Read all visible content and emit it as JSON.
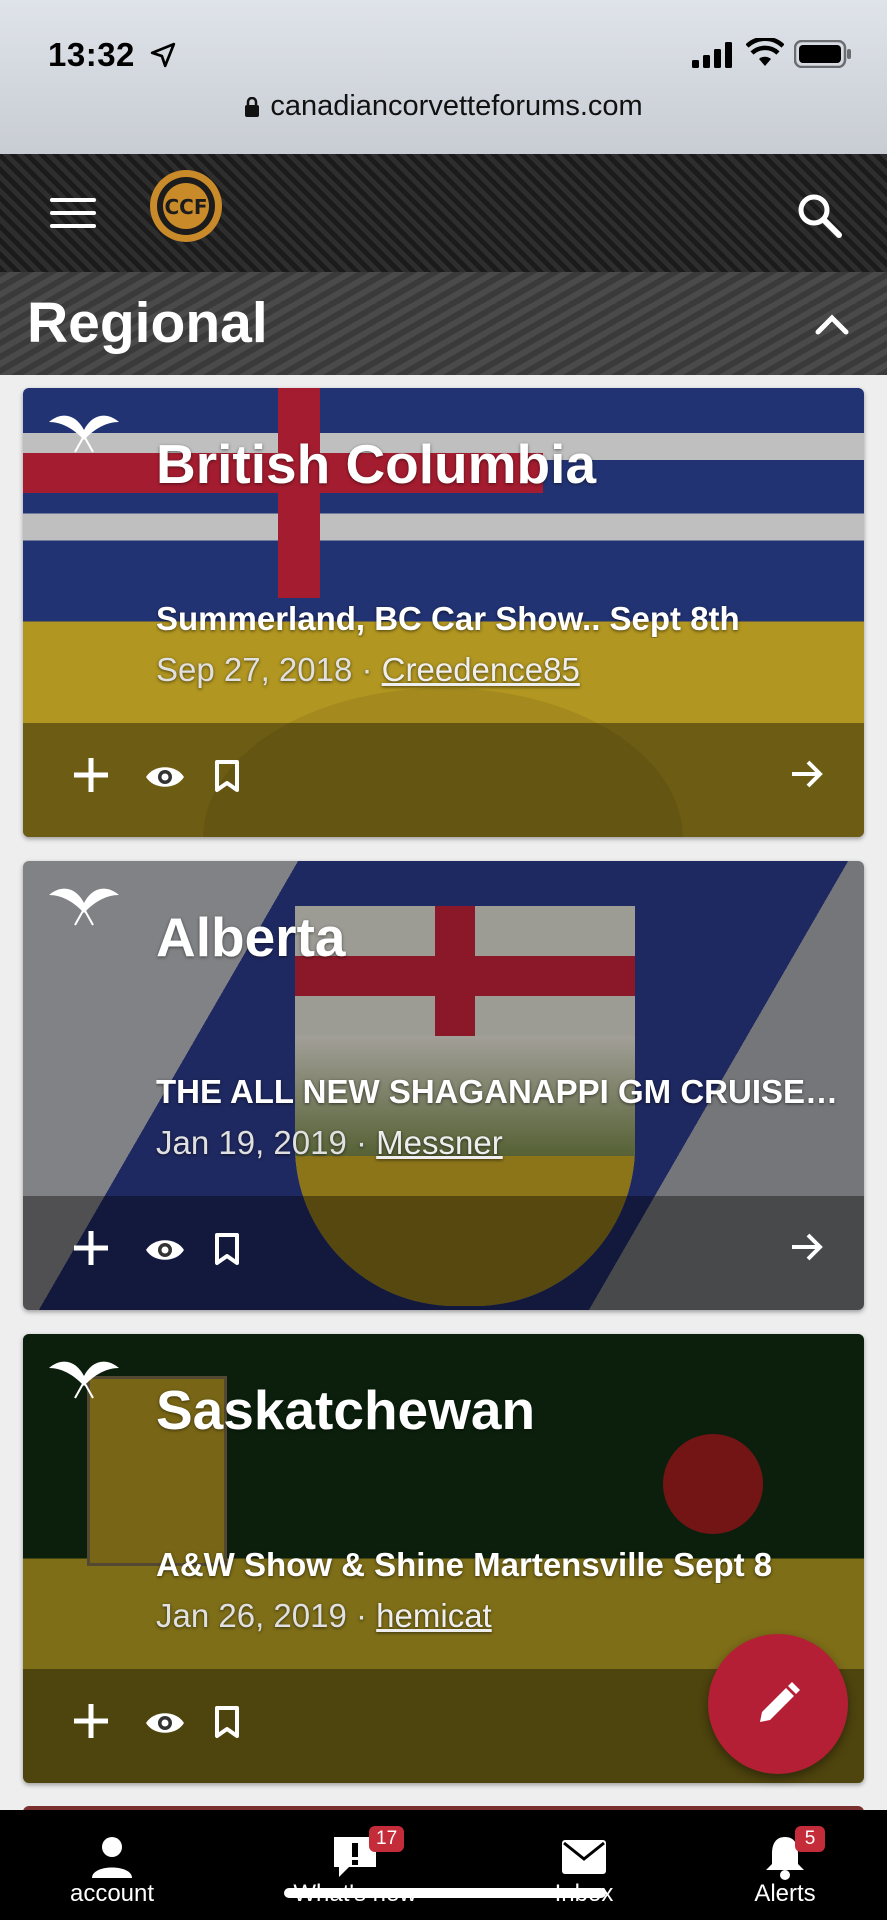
{
  "status_bar": {
    "time": "13:32",
    "url": "canadiancorvetteforums.com"
  },
  "header": {
    "logo_text": "CCF",
    "logo_ring_text": "CANADIAN CORVETTE FORUMS"
  },
  "section": {
    "title": "Regional"
  },
  "cards": [
    {
      "title": "British Columbia",
      "thread": "Summerland, BC Car Show.. Sept 8th",
      "date": "Sep 27, 2018",
      "separator": " · ",
      "author": "Creedence85"
    },
    {
      "title": "Alberta",
      "thread": "THE ALL NEW SHAGANAPPI GM CRUISE NIGHT",
      "date": "Jan 19, 2019",
      "separator": " · ",
      "author": "Messner"
    },
    {
      "title": "Saskatchewan",
      "thread": "A&W Show & Shine Martensville Sept 8",
      "date": "Jan 26, 2019",
      "separator": " · ",
      "author": "hemicat"
    }
  ],
  "tab_bar": {
    "tabs": [
      {
        "label": "account",
        "icon": "account-icon"
      },
      {
        "label": "What's new",
        "icon": "whats-new-icon",
        "badge": "17"
      },
      {
        "label": "Inbox",
        "icon": "inbox-icon"
      },
      {
        "label": "Alerts",
        "icon": "bell-icon",
        "badge": "5"
      }
    ]
  },
  "colors": {
    "accent": "#b41f35",
    "badge": "#c42c3a"
  }
}
